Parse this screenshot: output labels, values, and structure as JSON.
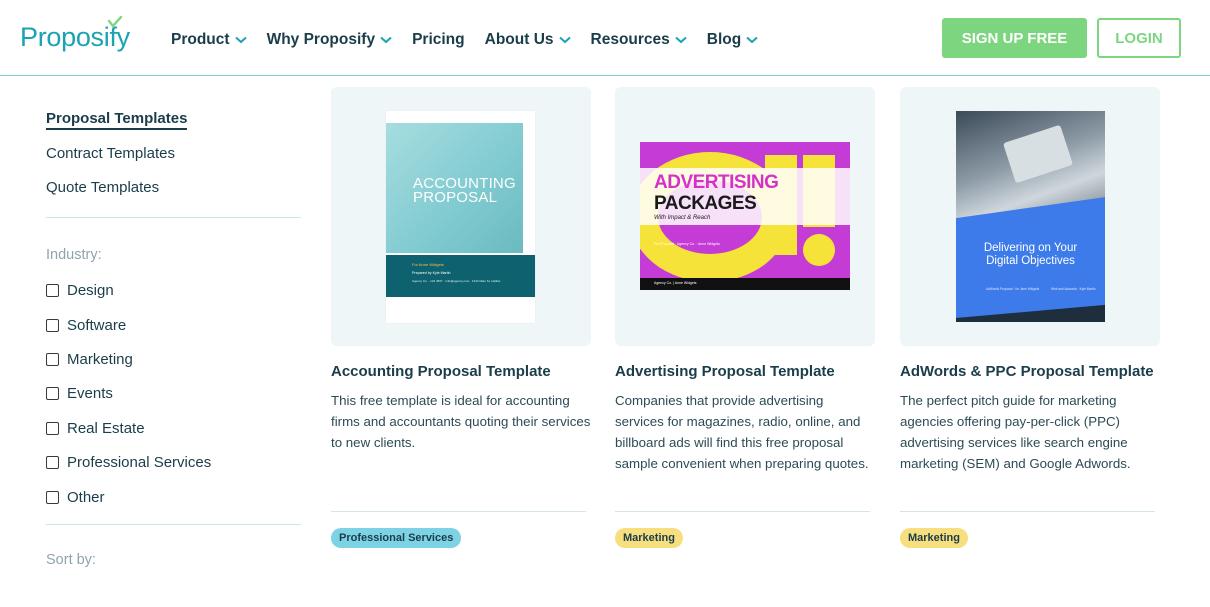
{
  "header": {
    "logo": "Proposify",
    "nav": [
      {
        "label": "Product",
        "has_dropdown": true
      },
      {
        "label": "Why Proposify",
        "has_dropdown": true
      },
      {
        "label": "Pricing",
        "has_dropdown": false
      },
      {
        "label": "About Us",
        "has_dropdown": true
      },
      {
        "label": "Resources",
        "has_dropdown": true
      },
      {
        "label": "Blog",
        "has_dropdown": true
      }
    ],
    "signup_label": "SIGN UP FREE",
    "login_label": "LOGIN"
  },
  "sidebar": {
    "links": [
      {
        "label": "Proposal Templates",
        "active": true
      },
      {
        "label": "Contract Templates",
        "active": false
      },
      {
        "label": "Quote Templates",
        "active": false
      }
    ],
    "industry_heading": "Industry:",
    "industries": [
      "Design",
      "Software",
      "Marketing",
      "Events",
      "Real Estate",
      "Professional Services",
      "Other"
    ],
    "sort_heading": "Sort by:"
  },
  "cards": [
    {
      "title": "Accounting Proposal Template",
      "description": "This free template is ideal for accounting firms and accountants quoting their services to new clients.",
      "tag": "Professional Services",
      "thumb": {
        "title_line1": "ACCOUNTING",
        "title_line2": "PROPOSAL",
        "for_line": "For Anne Widgets",
        "prepared_line": "Prepared by Kyle Martin",
        "details": "Agency Co. · 123 4567 · info@agency.com · 1234 Main St, Halifax"
      }
    },
    {
      "title": "Advertising Proposal Template",
      "description": "Companies that provide advertising services for magazines, radio, online, and billboard ads will find this free proposal sample convenient when preparing quotes.",
      "tag": "Marketing",
      "thumb": {
        "line1": "ADVERTISING",
        "line2": "PACKAGES",
        "line3": "With Impact & Reach",
        "small": "For Proposal · Agency Co. · Anne Widgets",
        "footer": "Agency Co. | Anne Widgets"
      }
    },
    {
      "title": "AdWords & PPC Proposal Template",
      "description": "The perfect pitch guide for marketing agencies offering pay-per-click (PPC) advertising services like search engine marketing (SEM) and Google Adwords.",
      "tag": "Marketing",
      "thumb": {
        "title_line1": "Delivering on Your",
        "title_line2": "Digital Objectives",
        "small_left": "AdWords Proposal · for Jane Widgets",
        "small_right": "Web and Adwords · Kyle Martin"
      }
    }
  ],
  "colors": {
    "brand": "#1aa3b3",
    "signup_bg": "#7dd67f",
    "tag_blue": "#7dd3e4",
    "tag_yellow": "#f7de7f",
    "text_dark": "#1a3d4a"
  }
}
